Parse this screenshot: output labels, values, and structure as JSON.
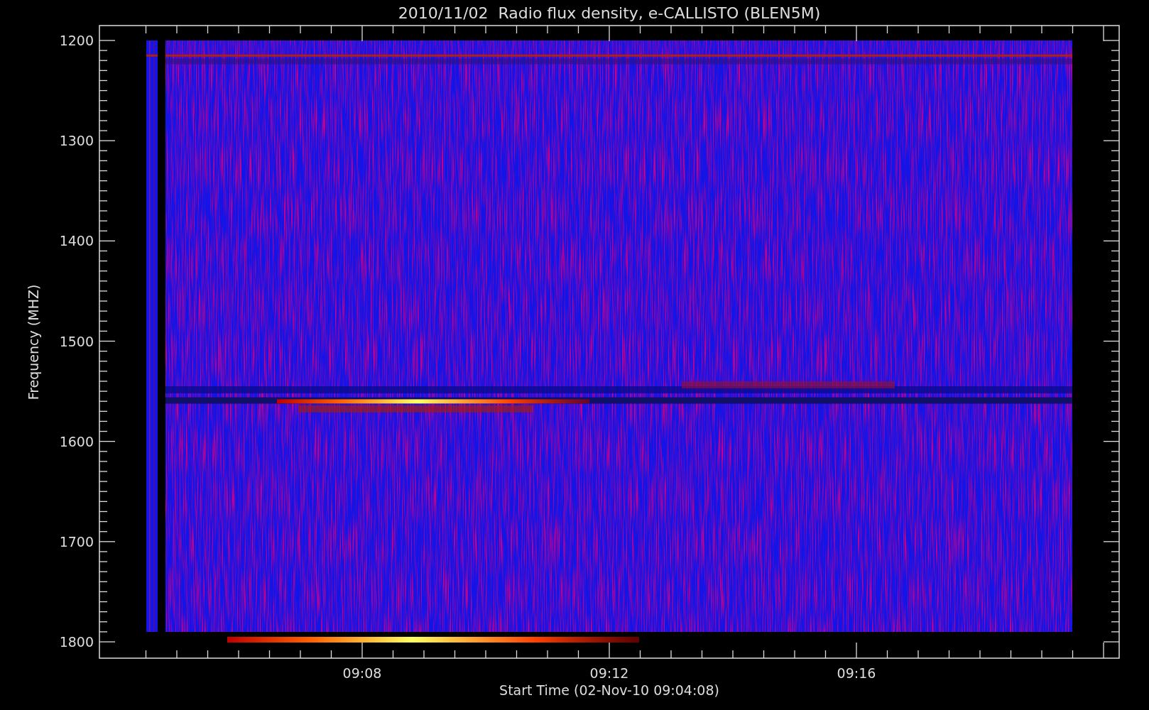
{
  "title": "2010/11/02  Radio flux density, e-CALLISTO (BLEN5M)",
  "y_axis": {
    "label": "Frequency (MHZ)",
    "ticks": [
      "1200",
      "1300",
      "1400",
      "1500",
      "1600",
      "1700",
      "1800"
    ]
  },
  "x_axis": {
    "label": "Start Time (02-Nov-10 09:04:08)",
    "ticks": [
      "09:08",
      "09:12",
      "09:16"
    ]
  }
}
